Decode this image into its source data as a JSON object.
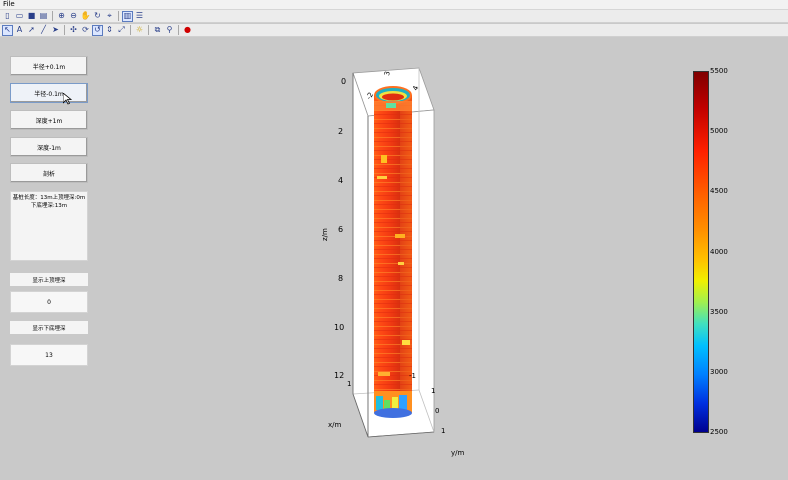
{
  "menu": {
    "file": "File"
  },
  "toolbar_row1": [
    {
      "icon": "new-file-icon",
      "glyph": "▯"
    },
    {
      "icon": "open-folder-icon",
      "glyph": "▭"
    },
    {
      "icon": "save-icon",
      "glyph": "■"
    },
    {
      "icon": "print-icon",
      "glyph": "▤"
    },
    {
      "icon": "zoom-in-icon",
      "glyph": "⊕"
    },
    {
      "icon": "zoom-out-icon",
      "glyph": "⊖"
    },
    {
      "icon": "pan-hand-icon",
      "glyph": "✋"
    },
    {
      "icon": "rotate-3d-icon",
      "glyph": "↻"
    },
    {
      "icon": "data-cursor-icon",
      "glyph": "⌖"
    },
    {
      "icon": "colorbar-toggle-icon",
      "glyph": "▥"
    },
    {
      "icon": "legend-toggle-icon",
      "glyph": "☰"
    }
  ],
  "toolbar_row2": [
    {
      "icon": "edit-plot-arrow-icon",
      "glyph": "↖"
    },
    {
      "icon": "text-tool-icon",
      "glyph": "A"
    },
    {
      "icon": "arrow-tool-icon",
      "glyph": "➚"
    },
    {
      "icon": "line-tool-icon",
      "glyph": "╱"
    },
    {
      "icon": "pointer-tool-icon",
      "glyph": "➤"
    },
    {
      "icon": "move-camera-icon",
      "glyph": "✣"
    },
    {
      "icon": "orbit-camera-icon",
      "glyph": "⟳"
    },
    {
      "icon": "roll-camera-icon",
      "glyph": "↺"
    },
    {
      "icon": "dolly-camera-icon",
      "glyph": "⇕"
    },
    {
      "icon": "zoom-camera-icon",
      "glyph": "⤢"
    },
    {
      "icon": "light-bulb-icon",
      "glyph": "☼"
    },
    {
      "icon": "copy-figure-icon",
      "glyph": "⧉"
    },
    {
      "icon": "link-plot-icon",
      "glyph": "⚲"
    },
    {
      "icon": "stop-icon",
      "glyph": "●"
    }
  ],
  "panel": {
    "btn_radius_plus": "半径+0.1m",
    "btn_radius_minus": "半径-0.1m",
    "btn_depth_plus": "深度+1m",
    "btn_depth_minus": "深度-1m",
    "btn_slice": "剖析",
    "info_line1": "基桩长度：13m上顶埋深:0m",
    "info_line2": "下底埋深:13m",
    "label_top_depth": "显示上顶埋深",
    "value_top_depth": "0",
    "label_bottom_depth": "显示下底埋深",
    "value_bottom_depth": "13"
  },
  "plot": {
    "z_label": "z/m",
    "x_label": "x/m",
    "y_label": "y/m",
    "z_ticks": [
      "0",
      "2",
      "4",
      "6",
      "8",
      "10",
      "12"
    ],
    "x_ticks": [
      "1",
      "-1"
    ],
    "y_ticks": [
      "1",
      "0",
      "1"
    ],
    "top_ticks": [
      "-2",
      "3",
      "4"
    ]
  },
  "colorbar": {
    "ticks": [
      "5500",
      "5000",
      "4500",
      "4000",
      "3500",
      "3000",
      "2500"
    ],
    "colors": [
      "#800000",
      "#ff2000",
      "#ff9000",
      "#f0f000",
      "#40e0c0",
      "#0080ff",
      "#00008f"
    ]
  }
}
